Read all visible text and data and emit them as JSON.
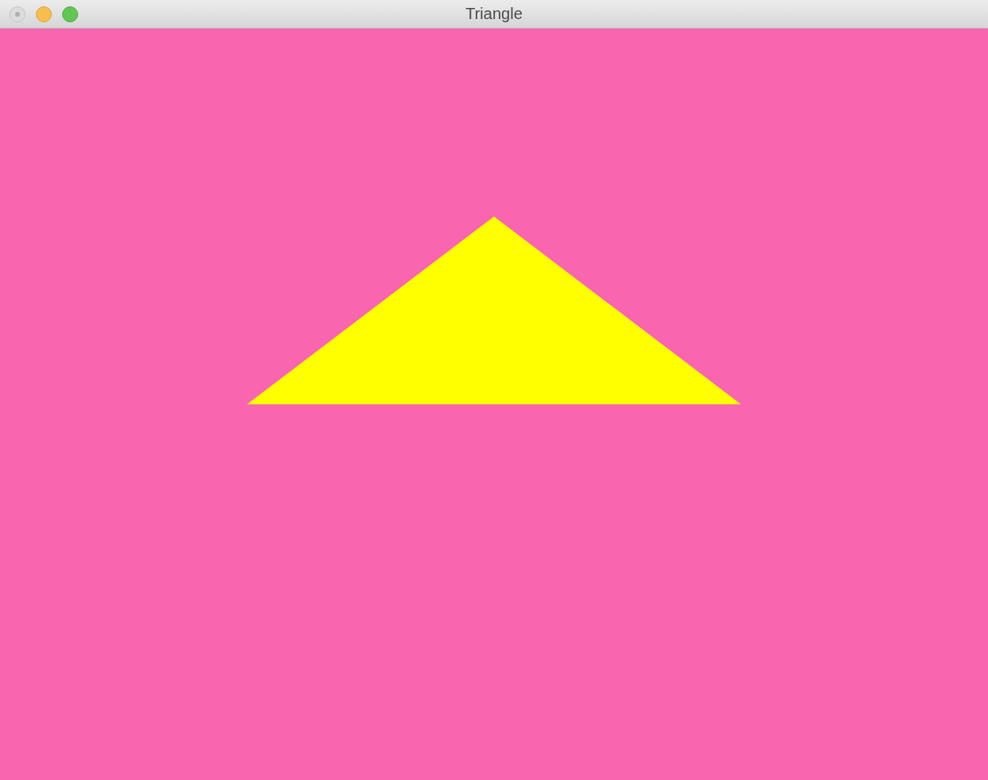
{
  "window": {
    "title": "Triangle"
  }
}
